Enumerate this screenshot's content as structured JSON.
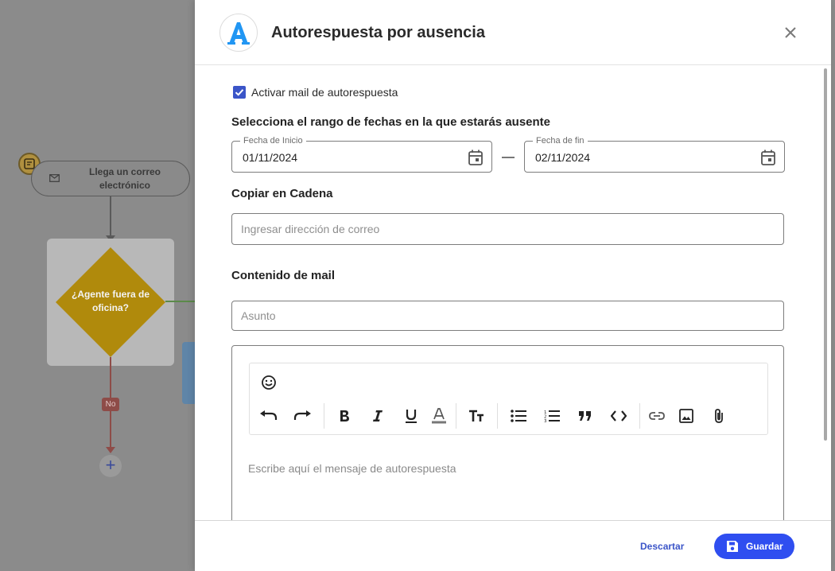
{
  "flow": {
    "trigger_label": "Llega un correo electrónico",
    "decision_label": "¿Agente fuera de oficina?",
    "branch_no_label": "No",
    "add_symbol": "+"
  },
  "modal": {
    "logo_letter": "A",
    "title": "Autorespuesta por ausencia",
    "activate_label": "Activar mail de autorespuesta",
    "activate_checked": true,
    "date_range_title": "Selecciona el rango de fechas en la que estarás ausente",
    "start_date": {
      "legend": "Fecha de Inicio",
      "value": "01/11/2024"
    },
    "end_date": {
      "legend": "Fecha de fin",
      "value": "02/11/2024"
    },
    "cc_title": "Copiar en Cadena",
    "cc_placeholder": "Ingresar dirección de correo",
    "content_title": "Contenido de mail",
    "subject_placeholder": "Asunto",
    "editor_placeholder": "Escribe aquí el mensaje de autorespuesta",
    "toolbar_icons": [
      "emoji-icon",
      "undo-icon",
      "redo-icon",
      "bold-icon",
      "italic-icon",
      "underline-icon",
      "text-color-icon",
      "font-size-icon",
      "bullet-list-icon",
      "numbered-list-icon",
      "quote-icon",
      "code-icon",
      "link-icon",
      "image-icon",
      "attachment-icon"
    ],
    "discard_label": "Descartar",
    "save_label": "Guardar"
  },
  "colors": {
    "accent": "#2f4ef0",
    "checkbox": "#3b55c8",
    "decision": "#f5b301",
    "logo": "#2196f3"
  }
}
